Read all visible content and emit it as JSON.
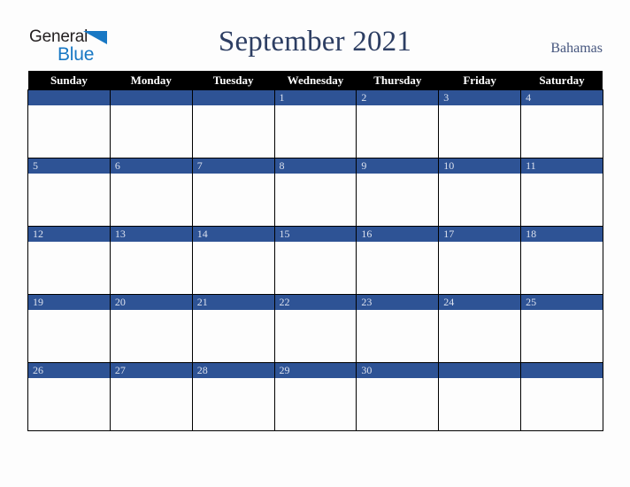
{
  "brand": {
    "name_part1": "General",
    "name_part2": "Blue",
    "triangle_icon": "triangle-right-icon",
    "colors": {
      "part1": "#231f20",
      "part2": "#1878c4",
      "triangle": "#1878c4"
    }
  },
  "calendar": {
    "title": "September 2021",
    "month": "September",
    "year": "2021",
    "country": "Bahamas",
    "colors": {
      "title": "#2d3e63",
      "country": "#46567e",
      "header_bg": "#000000",
      "header_text": "#ffffff",
      "date_bar_bg": "#2e5395",
      "date_text": "#dbe1ee",
      "cell_bg": "#fdfdfd",
      "grid_line": "#000000",
      "page_bg": "#fdfdfd"
    },
    "weekday_headers": [
      "Sunday",
      "Monday",
      "Tuesday",
      "Wednesday",
      "Thursday",
      "Friday",
      "Saturday"
    ],
    "weeks": [
      [
        "",
        "",
        "",
        "1",
        "2",
        "3",
        "4"
      ],
      [
        "5",
        "6",
        "7",
        "8",
        "9",
        "10",
        "11"
      ],
      [
        "12",
        "13",
        "14",
        "15",
        "16",
        "17",
        "18"
      ],
      [
        "19",
        "20",
        "21",
        "22",
        "23",
        "24",
        "25"
      ],
      [
        "26",
        "27",
        "28",
        "29",
        "30",
        "",
        ""
      ]
    ]
  }
}
